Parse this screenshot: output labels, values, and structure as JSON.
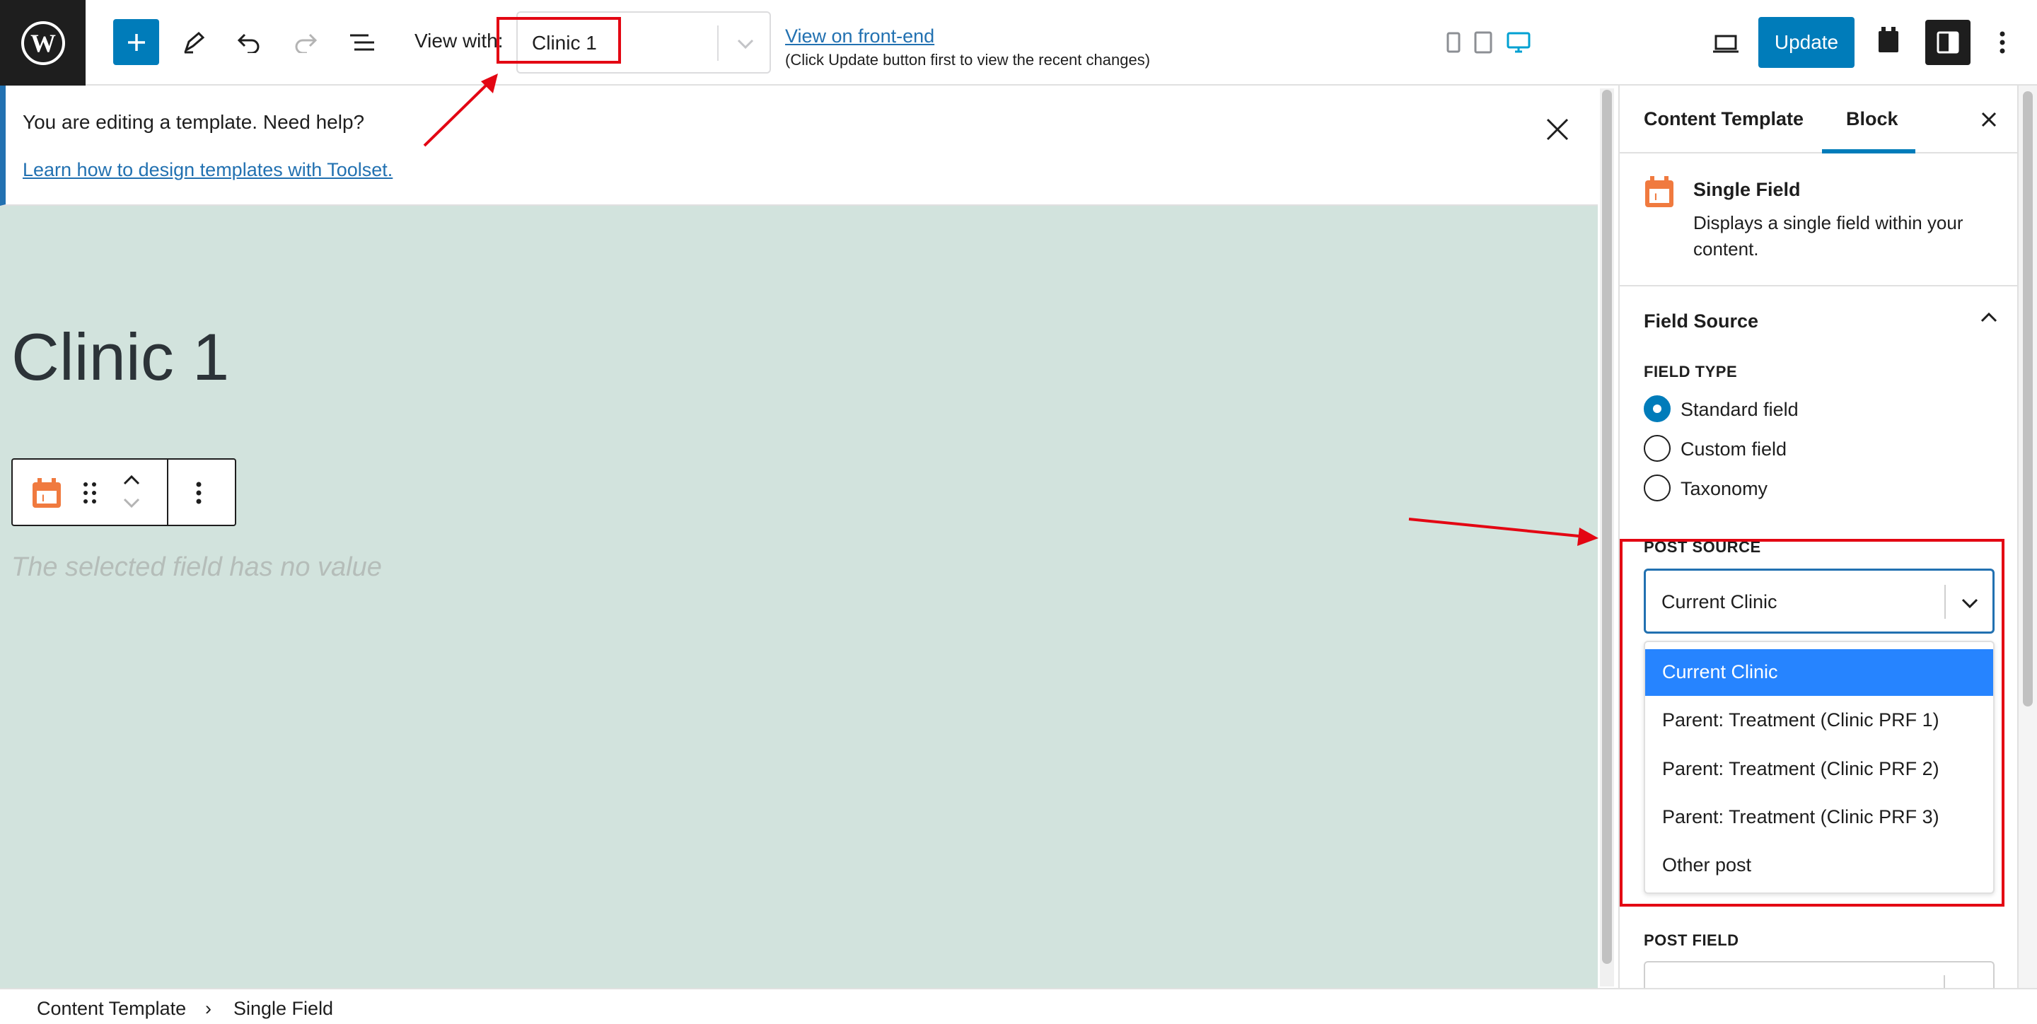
{
  "toolbar": {
    "view_with_label": "View with:",
    "view_with_value": "Clinic 1",
    "view_frontend_link": "View on front-end",
    "view_frontend_note": "(Click Update button first to view the recent changes)",
    "update_label": "Update",
    "accent_color": "#007cba"
  },
  "notice": {
    "text": "You are editing a template. Need help?",
    "link": "Learn how to design templates with Toolset."
  },
  "canvas": {
    "title": "Clinic 1",
    "placeholder": "The selected field has no value",
    "background": "#d2e3dd"
  },
  "sidebar": {
    "tabs": [
      {
        "label": "Content Template"
      },
      {
        "label": "Block"
      }
    ],
    "block": {
      "title": "Single Field",
      "description": "Displays a single field within your content."
    },
    "section_title": "Field Source",
    "field_type_caption": "FIELD TYPE",
    "field_type_options": [
      {
        "label": "Standard field",
        "checked": true
      },
      {
        "label": "Custom field",
        "checked": false
      },
      {
        "label": "Taxonomy",
        "checked": false
      }
    ],
    "post_source_caption": "POST SOURCE",
    "post_source_value": "Current Clinic",
    "post_source_options": [
      {
        "label": "Current Clinic",
        "selected": true
      },
      {
        "label": "Parent: Treatment (Clinic PRF 1)",
        "selected": false
      },
      {
        "label": "Parent: Treatment (Clinic PRF 2)",
        "selected": false
      },
      {
        "label": "Parent: Treatment (Clinic PRF 3)",
        "selected": false
      },
      {
        "label": "Other post",
        "selected": false
      }
    ],
    "post_field_caption": "POST FIELD"
  },
  "breadcrumb": {
    "items": [
      "Content Template",
      "Single Field"
    ],
    "separator": "›"
  },
  "annotation_color": "#e30613"
}
